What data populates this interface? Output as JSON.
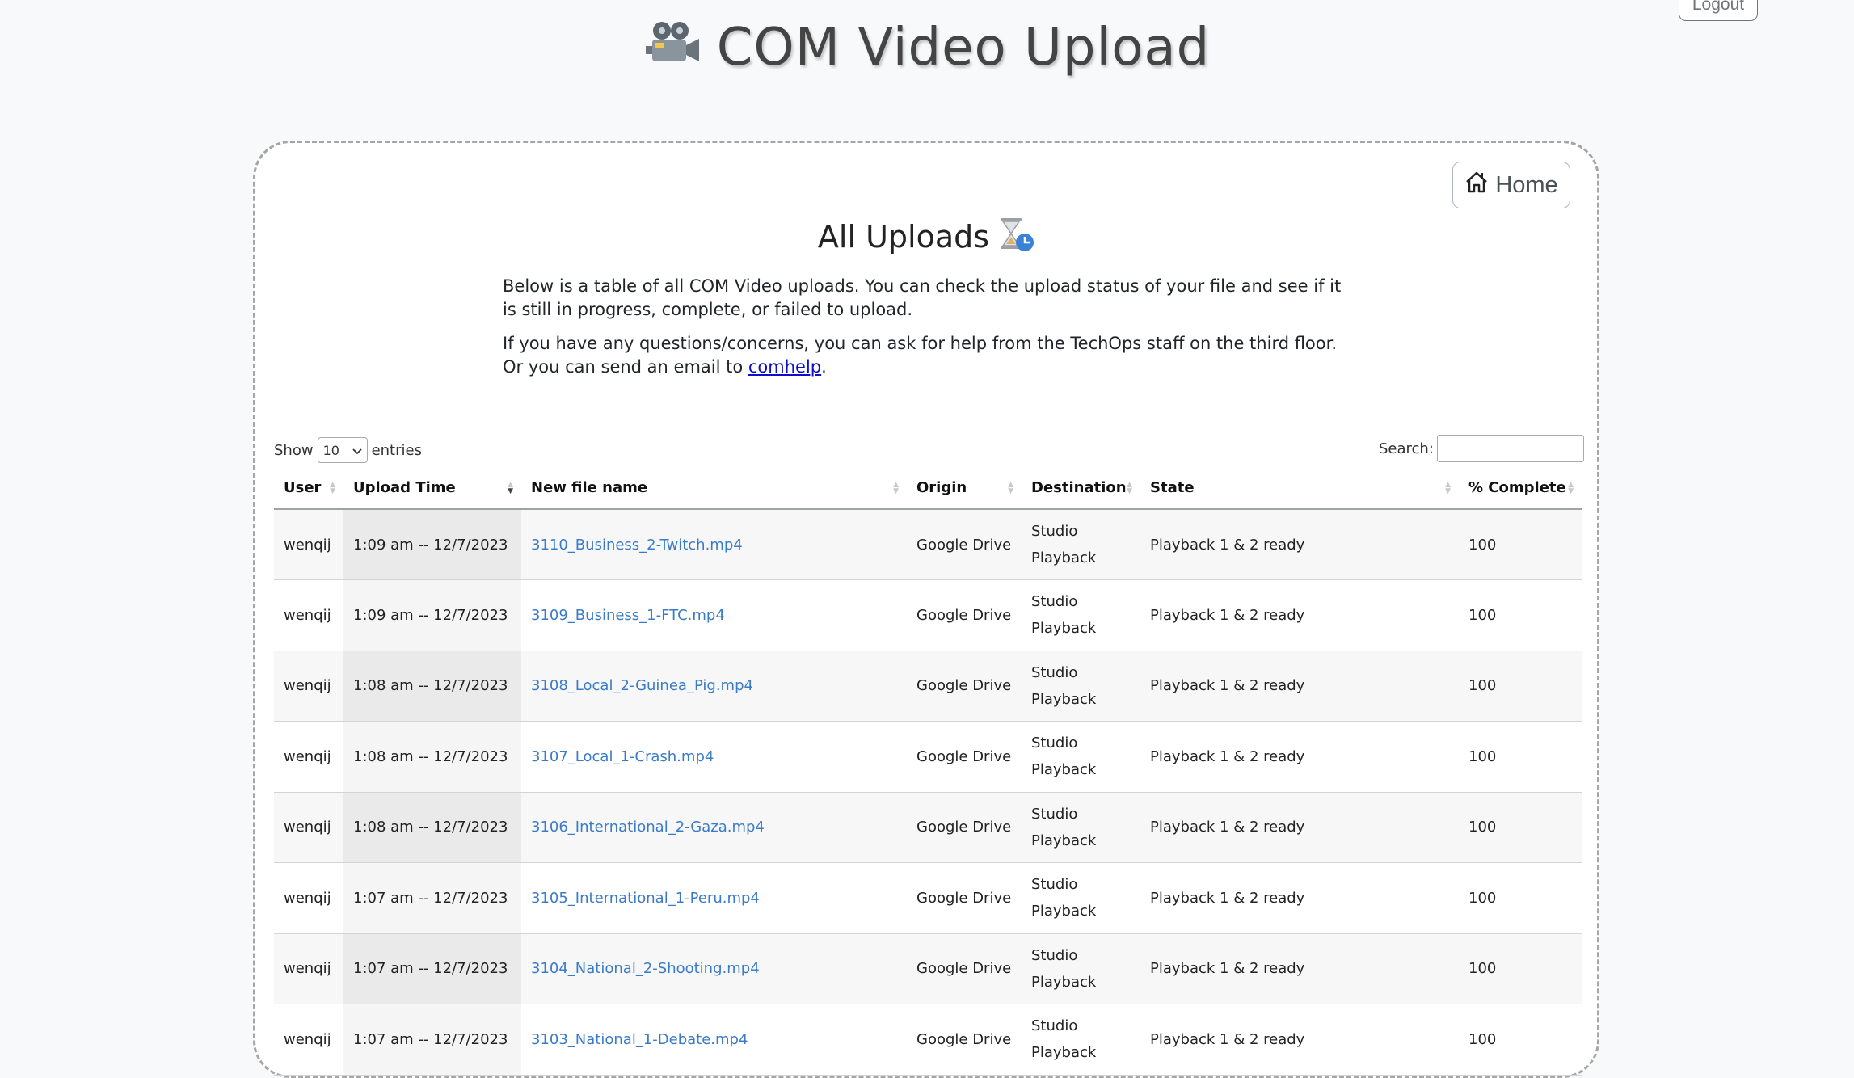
{
  "header": {
    "title": "COM Video Upload",
    "logout_label": "Logout",
    "camera_icon": "movie-camera-icon"
  },
  "panel": {
    "home_label": "Home",
    "home_icon": "house-icon",
    "title": "All Uploads",
    "title_icon": "hourglass-icon",
    "intro_p1": "Below is a table of all COM Video uploads. You can check the upload status of your file and see if it is still in progress, complete, or failed to upload.",
    "intro_p2_before": "If you have any questions/concerns, you can ask for help from the TechOps staff on the third floor. Or you can send an email to ",
    "intro_link": "comhelp",
    "intro_p2_after": "."
  },
  "table_controls": {
    "show_label": "Show",
    "entries_value": "10",
    "entries_label": "entries",
    "search_label": "Search:",
    "search_value": ""
  },
  "table": {
    "columns": [
      "User",
      "Upload Time",
      "New file name",
      "Origin",
      "Destination",
      "State",
      "% Complete"
    ],
    "sorted_column": "Upload Time",
    "sort_direction": "descending",
    "rows": [
      {
        "user": "wenqij",
        "time": "1:09 am -- 12/7/2023",
        "file": "3110_Business_2-Twitch.mp4",
        "origin": "Google Drive",
        "dest1": "Studio",
        "dest2": "Playback",
        "state": "Playback 1 & 2 ready",
        "pct": "100"
      },
      {
        "user": "wenqij",
        "time": "1:09 am -- 12/7/2023",
        "file": "3109_Business_1-FTC.mp4",
        "origin": "Google Drive",
        "dest1": "Studio",
        "dest2": "Playback",
        "state": "Playback 1 & 2 ready",
        "pct": "100"
      },
      {
        "user": "wenqij",
        "time": "1:08 am -- 12/7/2023",
        "file": "3108_Local_2-Guinea_Pig.mp4",
        "origin": "Google Drive",
        "dest1": "Studio",
        "dest2": "Playback",
        "state": "Playback 1 & 2 ready",
        "pct": "100"
      },
      {
        "user": "wenqij",
        "time": "1:08 am -- 12/7/2023",
        "file": "3107_Local_1-Crash.mp4",
        "origin": "Google Drive",
        "dest1": "Studio",
        "dest2": "Playback",
        "state": "Playback 1 & 2 ready",
        "pct": "100"
      },
      {
        "user": "wenqij",
        "time": "1:08 am -- 12/7/2023",
        "file": "3106_International_2-Gaza.mp4",
        "origin": "Google Drive",
        "dest1": "Studio",
        "dest2": "Playback",
        "state": "Playback 1 & 2 ready",
        "pct": "100"
      },
      {
        "user": "wenqij",
        "time": "1:07 am -- 12/7/2023",
        "file": "3105_International_1-Peru.mp4",
        "origin": "Google Drive",
        "dest1": "Studio",
        "dest2": "Playback",
        "state": "Playback 1 & 2 ready",
        "pct": "100"
      },
      {
        "user": "wenqij",
        "time": "1:07 am -- 12/7/2023",
        "file": "3104_National_2-Shooting.mp4",
        "origin": "Google Drive",
        "dest1": "Studio",
        "dest2": "Playback",
        "state": "Playback 1 & 2 ready",
        "pct": "100"
      },
      {
        "user": "wenqij",
        "time": "1:07 am -- 12/7/2023",
        "file": "3103_National_1-Debate.mp4",
        "origin": "Google Drive",
        "dest1": "Studio",
        "dest2": "Playback",
        "state": "Playback 1 & 2 ready",
        "pct": "100"
      }
    ]
  }
}
